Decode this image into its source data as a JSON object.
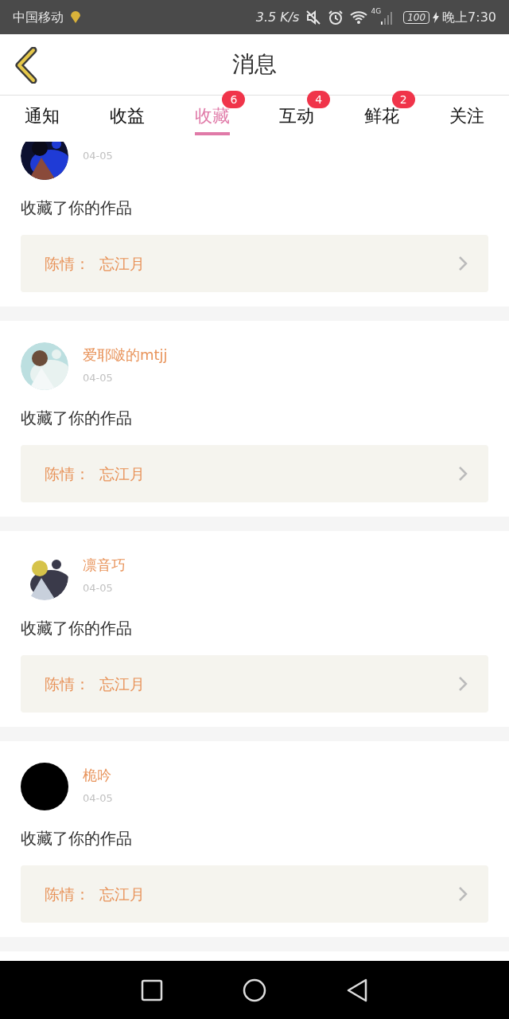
{
  "status_bar": {
    "carrier": "中国移动",
    "speed": "3.5 K/s",
    "network": "4G",
    "battery": "100",
    "time": "晚上7:30"
  },
  "header": {
    "title": "消息"
  },
  "tabs": [
    {
      "label": "通知",
      "selected": false
    },
    {
      "label": "收益",
      "selected": false
    },
    {
      "label": "收藏",
      "selected": true,
      "badge": "6"
    },
    {
      "label": "互动",
      "selected": false,
      "badge": "4"
    },
    {
      "label": "鲜花",
      "selected": false,
      "badge": "2"
    },
    {
      "label": "关注",
      "selected": false
    }
  ],
  "messages": [
    {
      "date": "04-05",
      "text": "收藏了你的作品",
      "work": "陈情：  忘江月"
    },
    {
      "name": "爱耶啵的mtjj",
      "date": "04-05",
      "text": "收藏了你的作品",
      "work": "陈情：  忘江月"
    },
    {
      "name": "凛音巧",
      "date": "04-05",
      "text": "收藏了你的作品",
      "work": "陈情：  忘江月"
    },
    {
      "avatar": {
        "kind": "plain"
      },
      "name": "桅吟",
      "date": "04-05",
      "text": "收藏了你的作品",
      "work": "陈情：  忘江月"
    }
  ]
}
